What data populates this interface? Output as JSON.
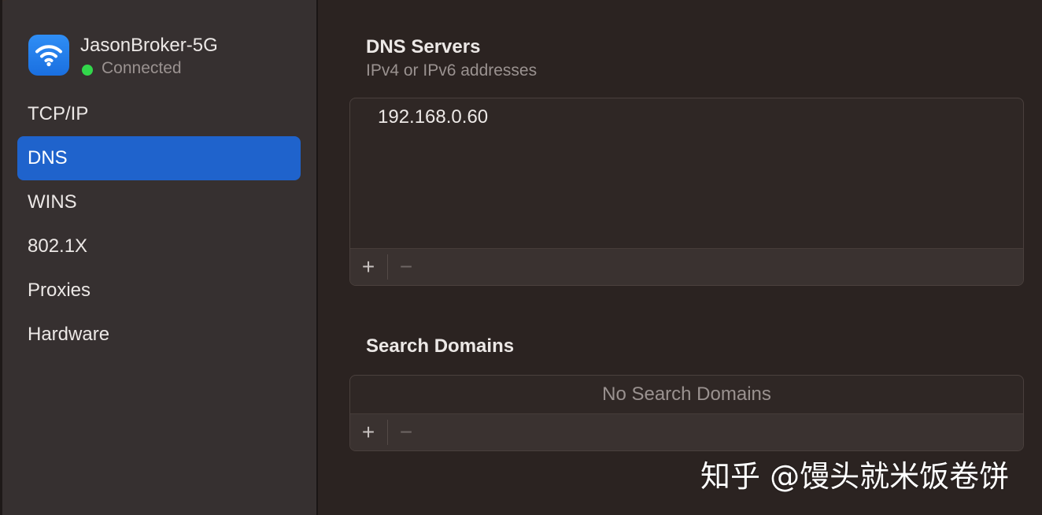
{
  "network": {
    "name": "JasonBroker-5G",
    "status": "Connected",
    "icon": "wifi-icon",
    "status_color": "#32d74b",
    "badge_color": "#2f8ef5"
  },
  "sidebar": {
    "items": [
      {
        "label": "TCP/IP",
        "active": false
      },
      {
        "label": "DNS",
        "active": true
      },
      {
        "label": "WINS",
        "active": false
      },
      {
        "label": "802.1X",
        "active": false
      },
      {
        "label": "Proxies",
        "active": false
      },
      {
        "label": "Hardware",
        "active": false
      }
    ],
    "active_color": "#1f63cc"
  },
  "dns": {
    "title": "DNS Servers",
    "subtitle": "IPv4 or IPv6 addresses",
    "servers": [
      "192.168.0.60"
    ],
    "add_label": "+",
    "remove_label": "−"
  },
  "search": {
    "title": "Search Domains",
    "empty_message": "No Search Domains",
    "add_label": "+",
    "remove_label": "−"
  },
  "watermark": {
    "text": "知乎 @馒头就米饭卷饼"
  }
}
